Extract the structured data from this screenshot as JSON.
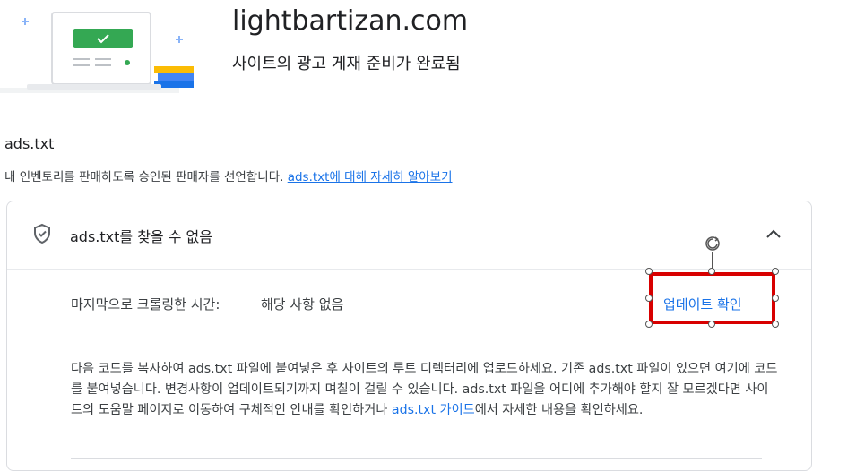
{
  "header": {
    "site": "lightbartizan.com",
    "subtitle": "사이트의 광고 게재 준비가 완료됨"
  },
  "ads_section": {
    "heading": "ads.txt",
    "description": "내 인벤토리를 판매하도록 승인된 판매자를 선언합니다. ",
    "learn_more_link": "ads.txt에 대해 자세히 알아보기"
  },
  "status_card": {
    "title": "ads.txt를 찾을 수 없음",
    "crawl_label": "마지막으로 크롤링한 시간:",
    "crawl_value": "해당 사항 없음",
    "check_update_button": "업데이트 확인",
    "instructions_text": "다음 코드를 복사하여 ads.txt 파일에 붙여넣은 후 사이트의 루트 디렉터리에 업로드하세요. 기존 ads.txt 파일이 있으면 여기에 코드를 붙여넣습니다. 변경사항이 업데이트되기까지 며칠이 걸릴 수 있습니다. ads.txt 파일을 어디에 추가해야 할지 잘 모르겠다면 사이트의 도움말 페이지로 이동하여 구체적인 안내를 확인하거나 ",
    "guide_link": "ads.txt 가이드",
    "instructions_tail": "에서 자세한 내용을 확인하세요."
  },
  "icons": {
    "shield": "shield-check-icon",
    "chevron": "chevron-up-icon",
    "rotate": "rotate-icon"
  },
  "colors": {
    "link": "#1a73e8",
    "highlight": "#d80000",
    "check_green": "#34a853"
  }
}
